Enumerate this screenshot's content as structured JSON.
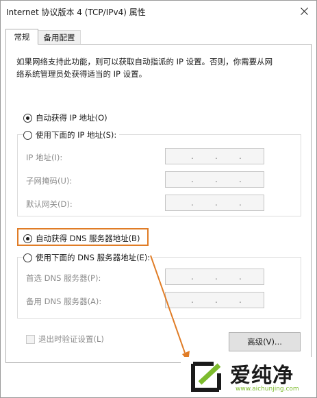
{
  "window": {
    "title": "Internet 协议版本 4 (TCP/IPv4) 属性",
    "close_icon": "close-icon"
  },
  "tabs": [
    {
      "label": "常规",
      "selected": true
    },
    {
      "label": "备用配置",
      "selected": false
    }
  ],
  "description": {
    "line1": "如果网络支持此功能，则可以获取自动指派的 IP 设置。否则，你需要从网",
    "line2": "络系统管理员处获得适当的 IP 设置。"
  },
  "ip_section": {
    "auto_label": "自动获得 IP 地址(O)",
    "auto_checked": true,
    "manual_label": "使用下面的 IP 地址(S):",
    "manual_checked": false,
    "fields": [
      {
        "label": "IP 地址(I):"
      },
      {
        "label": "子网掩码(U):"
      },
      {
        "label": "默认网关(D):"
      }
    ]
  },
  "dns_section": {
    "auto_label": "自动获得 DNS 服务器地址(B)",
    "auto_checked": true,
    "manual_label": "使用下面的 DNS 服务器地址(E):",
    "manual_checked": false,
    "fields": [
      {
        "label": "首选 DNS 服务器(P):"
      },
      {
        "label": "备用 DNS 服务器(A):"
      }
    ]
  },
  "footer": {
    "validate_label": "退出时验证设置(L)",
    "validate_checked": false,
    "advanced_label": "高级(V)..."
  },
  "annotation": {
    "highlight_color": "#e07c26"
  },
  "watermark": {
    "brand": "爱纯净",
    "url": "www.aichunjing.com",
    "accent_color": "#7dbb2e"
  }
}
